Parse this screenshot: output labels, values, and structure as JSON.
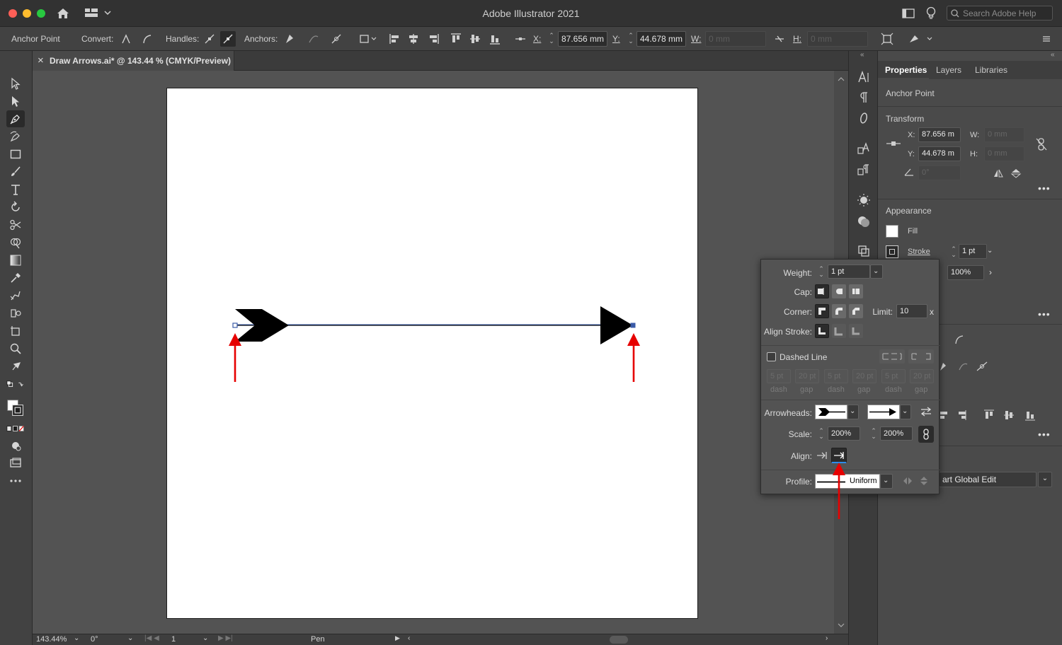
{
  "app": {
    "title": "Adobe Illustrator 2021",
    "search_placeholder": "Search Adobe Help"
  },
  "control_bar": {
    "selection_label": "Anchor Point",
    "convert_label": "Convert:",
    "handles_label": "Handles:",
    "anchors_label": "Anchors:",
    "x_label": "X:",
    "x_value": "87.656 mm",
    "y_label": "Y:",
    "y_value": "44.678 mm",
    "w_label": "W:",
    "w_value": "0 mm",
    "h_label": "H:",
    "h_value": "0 mm"
  },
  "document_tab": {
    "label": "Draw Arrows.ai* @ 143.44 % (CMYK/Preview)",
    "close_glyph": "×"
  },
  "status_bar": {
    "zoom": "143.44%",
    "rotation": "0°",
    "artboard": "1",
    "tool": "Pen"
  },
  "properties": {
    "tabs": [
      "Properties",
      "Layers",
      "Libraries"
    ],
    "selection_title": "Anchor Point",
    "transform": {
      "title": "Transform",
      "x_label": "X:",
      "x_value": "87.656 m",
      "y_label": "Y:",
      "y_value": "44.678 m",
      "w_label": "W:",
      "w_value": "0 mm",
      "h_label": "H:",
      "h_value": "0 mm",
      "angle_value": "0°"
    },
    "appearance": {
      "title": "Appearance",
      "fill_label": "Fill",
      "stroke_label": "Stroke",
      "stroke_weight": "1 pt",
      "opacity": "100%"
    },
    "global_edit_label": "art Global Edit"
  },
  "stroke_panel": {
    "weight_label": "Weight:",
    "weight_value": "1 pt",
    "cap_label": "Cap:",
    "corner_label": "Corner:",
    "limit_label": "Limit:",
    "limit_value": "10",
    "limit_x": "x",
    "align_stroke_label": "Align Stroke:",
    "dashed_line_label": "Dashed Line",
    "dash_fields": [
      {
        "value": "5 pt",
        "caption": "dash"
      },
      {
        "value": "20 pt",
        "caption": "gap"
      },
      {
        "value": "5 pt",
        "caption": "dash"
      },
      {
        "value": "20 pt",
        "caption": "gap"
      },
      {
        "value": "5 pt",
        "caption": "dash"
      },
      {
        "value": "20 pt",
        "caption": "gap"
      }
    ],
    "arrowheads_label": "Arrowheads:",
    "scale_label": "Scale:",
    "scale_start": "200%",
    "scale_end": "200%",
    "align_label": "Align:",
    "profile_label": "Profile:",
    "profile_value": "Uniform"
  },
  "colors": {
    "ui_dark": "#323232",
    "ui_mid": "#424242",
    "panel": "#4a4a4a",
    "canvas": "#535353",
    "artboard": "#ffffff",
    "path_selection": "#3a5ba8",
    "annotation_arrow": "#e60000"
  },
  "icons": [
    "home-icon",
    "workspace-icon",
    "lightbulb-icon",
    "search-icon",
    "pen-tool-icon",
    "selection-tool-icon",
    "direct-selection-icon",
    "rectangle-tool-icon",
    "type-tool-icon",
    "rotate-tool-icon",
    "scissors-icon",
    "gradient-icon",
    "eyedropper-icon",
    "zoom-icon",
    "link-icon",
    "swap-icon",
    "chevron-down-icon"
  ]
}
